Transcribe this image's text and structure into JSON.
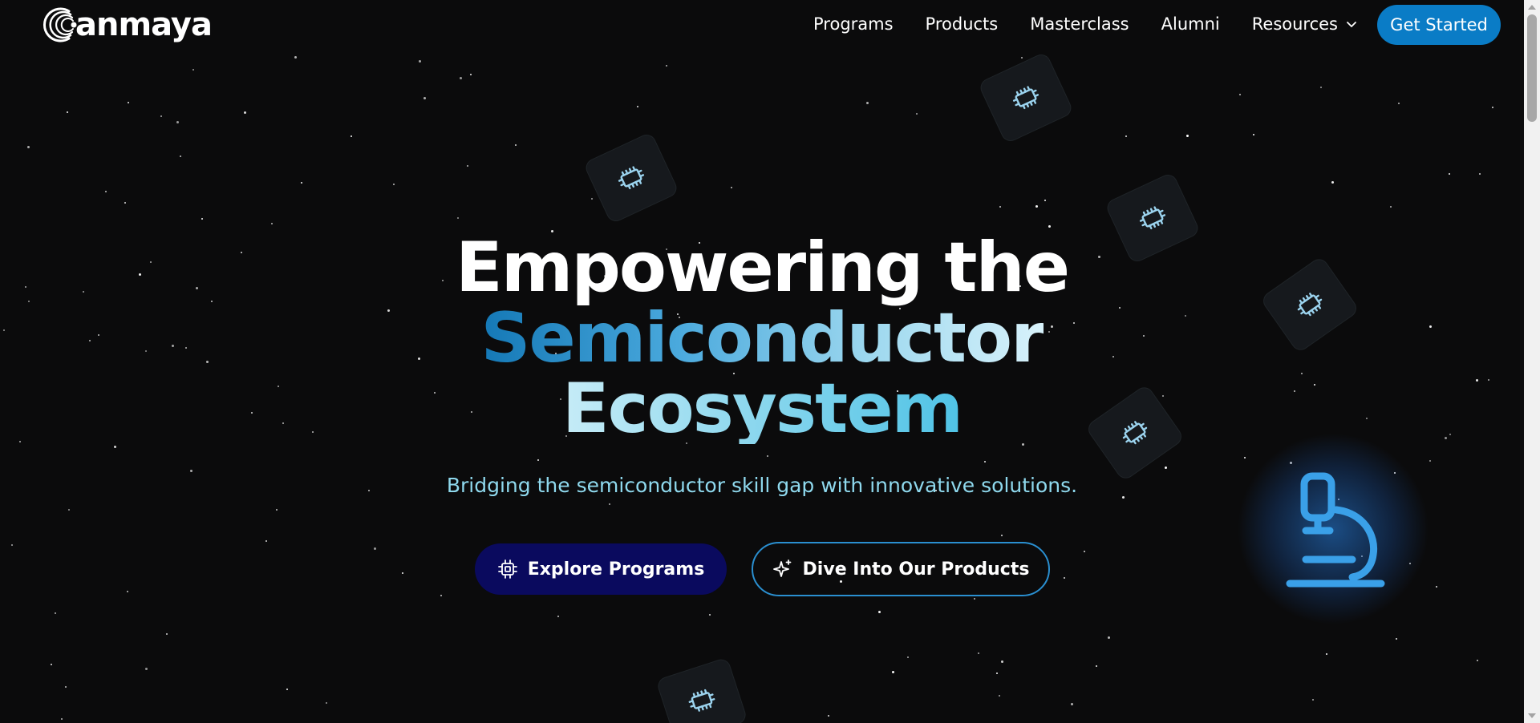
{
  "brand": {
    "name": "anmaya",
    "logo_icon": "concentric-arcs-logo"
  },
  "nav": {
    "links": [
      {
        "label": "Programs"
      },
      {
        "label": "Products"
      },
      {
        "label": "Masterclass"
      },
      {
        "label": "Alumni"
      },
      {
        "label": "Resources",
        "icon": "chevron-down-icon"
      }
    ],
    "cta_label": "Get Started"
  },
  "hero": {
    "title_line1": "Empowering the",
    "title_line2": "Semiconductor",
    "title_line3": "Ecosystem",
    "subtitle": "Bridging the semiconductor skill gap with innovative solutions.",
    "primary_button": {
      "label": "Explore Programs",
      "icon": "cpu-chip-icon"
    },
    "secondary_button": {
      "label": "Dive Into Our Products",
      "icon": "sparkle-icon"
    }
  },
  "decor": {
    "floating_icon": "chip-icon",
    "feature_icon": "microscope-icon"
  },
  "colors": {
    "background": "#0b0b0c",
    "accent_blue": "#0a7cc6",
    "primary_button_bg": "#0a0a5e",
    "outline_button_border": "#2a8fd0",
    "subtitle_text": "#8fd9ee",
    "chip_icon": "#9bd3ee",
    "microscope": "#3aa0e8"
  }
}
